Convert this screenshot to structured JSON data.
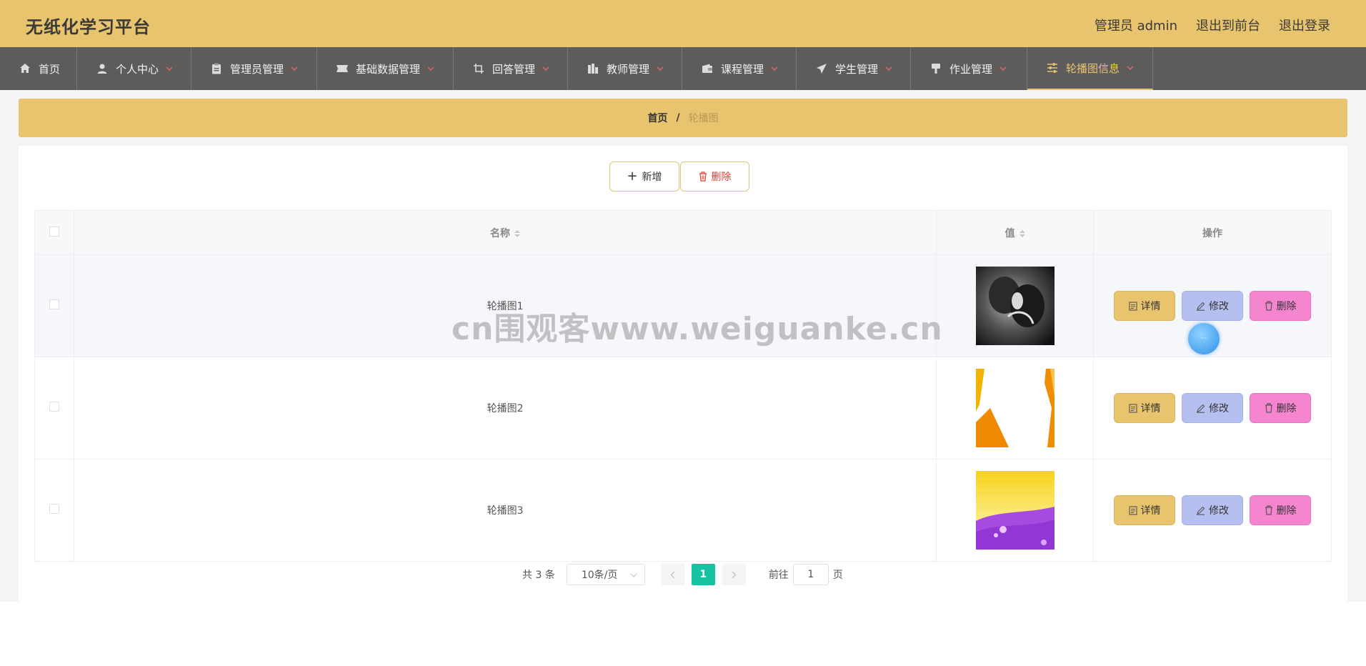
{
  "app": {
    "title": "无纸化学习平台",
    "user_label": "管理员 admin",
    "to_front_label": "退出到前台",
    "logout_label": "退出登录"
  },
  "nav": [
    {
      "label": "首页",
      "icon": "home-icon",
      "has_caret": false,
      "active": false
    },
    {
      "label": "个人中心",
      "icon": "user-icon",
      "has_caret": true,
      "active": false
    },
    {
      "label": "管理员管理",
      "icon": "clipboard-icon",
      "has_caret": true,
      "active": false
    },
    {
      "label": "基础数据管理",
      "icon": "ticket-icon",
      "has_caret": true,
      "active": false
    },
    {
      "label": "回答管理",
      "icon": "crop-icon",
      "has_caret": true,
      "active": false
    },
    {
      "label": "教师管理",
      "icon": "chart-icon",
      "has_caret": true,
      "active": false
    },
    {
      "label": "课程管理",
      "icon": "wallet-icon",
      "has_caret": true,
      "active": false
    },
    {
      "label": "学生管理",
      "icon": "send-icon",
      "has_caret": true,
      "active": false
    },
    {
      "label": "作业管理",
      "icon": "brush-icon",
      "has_caret": true,
      "active": false
    },
    {
      "label": "轮播图信息",
      "icon": "sliders-icon",
      "has_caret": true,
      "active": true
    }
  ],
  "breadcrumb": {
    "home": "首页",
    "separator": "/",
    "current": "轮播图"
  },
  "toolbar": {
    "add_label": "新增",
    "delete_label": "删除"
  },
  "table": {
    "headers": {
      "name": "名称",
      "value": "值",
      "actions": "操作"
    },
    "rows": [
      {
        "name": "轮播图1",
        "image": "dark-couple-photo"
      },
      {
        "name": "轮播图2",
        "image": "orange-geometric-banner"
      },
      {
        "name": "轮播图3",
        "image": "yellow-purple-banner"
      }
    ],
    "action_labels": {
      "detail": "详情",
      "edit": "修改",
      "delete": "删除"
    }
  },
  "pagination": {
    "total_text": "共 3 条",
    "page_size": "10条/页",
    "current_page": "1",
    "goto_prefix": "前往",
    "goto_value": "1",
    "goto_suffix": "页"
  },
  "watermark": "cn围观客www.weiguanke.cn",
  "colors": {
    "header_bg": "#e8c46e",
    "nav_bg": "#5e5c5a",
    "detail_btn": "#e8c46e",
    "edit_btn": "#b5bff0",
    "delete_btn": "#f585cf",
    "page_active": "#16c2a0"
  }
}
